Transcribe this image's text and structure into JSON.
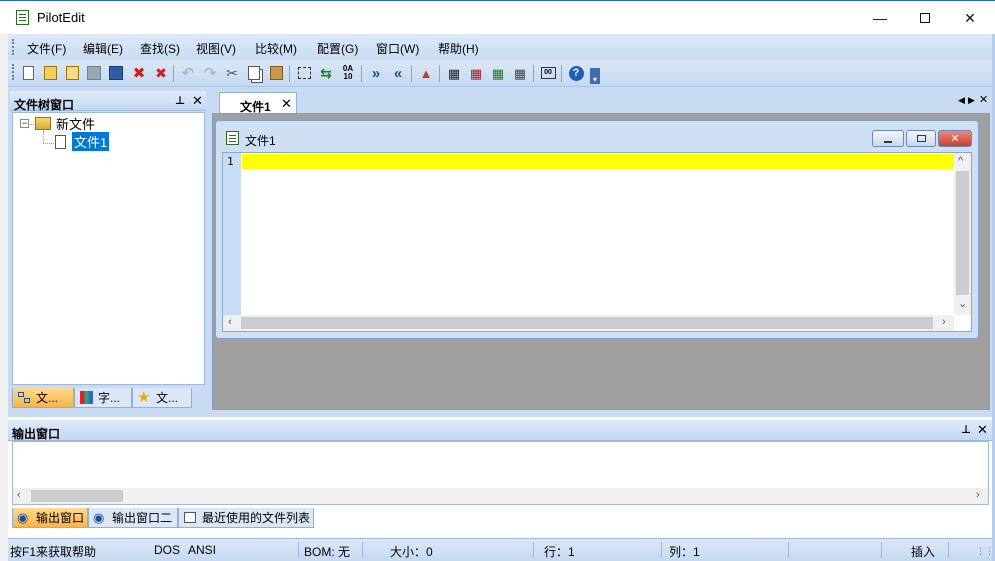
{
  "window": {
    "title": "PilotEdit"
  },
  "menu": [
    "文件(F)",
    "编辑(E)",
    "查找(S)",
    "视图(V)",
    "比较(M)",
    "配置(G)",
    "窗口(W)",
    "帮助(H)"
  ],
  "toolbar_icons": [
    "new-icon",
    "open-icon",
    "open-recent-icon",
    "save-icon",
    "save-all-icon",
    "close-icon",
    "close-all-icon",
    "undo-icon",
    "redo-icon",
    "cut-icon",
    "copy-icon",
    "paste-icon",
    "select-icon",
    "replace-icon",
    "hex-icon",
    "next-icon",
    "previous-icon",
    "clear-icon",
    "compare-icon",
    "compare-next-icon",
    "compare-prev-icon",
    "compare-stop-icon",
    "macro-icon",
    "help-icon"
  ],
  "toolbar_hex_label": "0A\n10",
  "file_tree": {
    "title": "文件树窗口",
    "root": "新文件",
    "child": "文件1",
    "tabs": [
      "文...",
      "字...",
      "文..."
    ]
  },
  "document": {
    "tab_label": "文件1",
    "window_title": "文件1",
    "line_number": "1",
    "highlight_color": "#ffff00"
  },
  "output": {
    "title": "输出窗口",
    "tabs": [
      "输出窗口",
      "输出窗口二",
      "最近使用的文件列表"
    ]
  },
  "status": {
    "help": "按F1来获取帮助",
    "line_ending": "DOS",
    "encoding": "ANSI",
    "bom": "BOM: 无",
    "size": "大小：0",
    "line": "行：1",
    "column": "列：1",
    "mode": "插入"
  },
  "colors": {
    "frame": "#c8dbf3",
    "active_tab": "#f8b44a",
    "selection": "#0078d7"
  }
}
